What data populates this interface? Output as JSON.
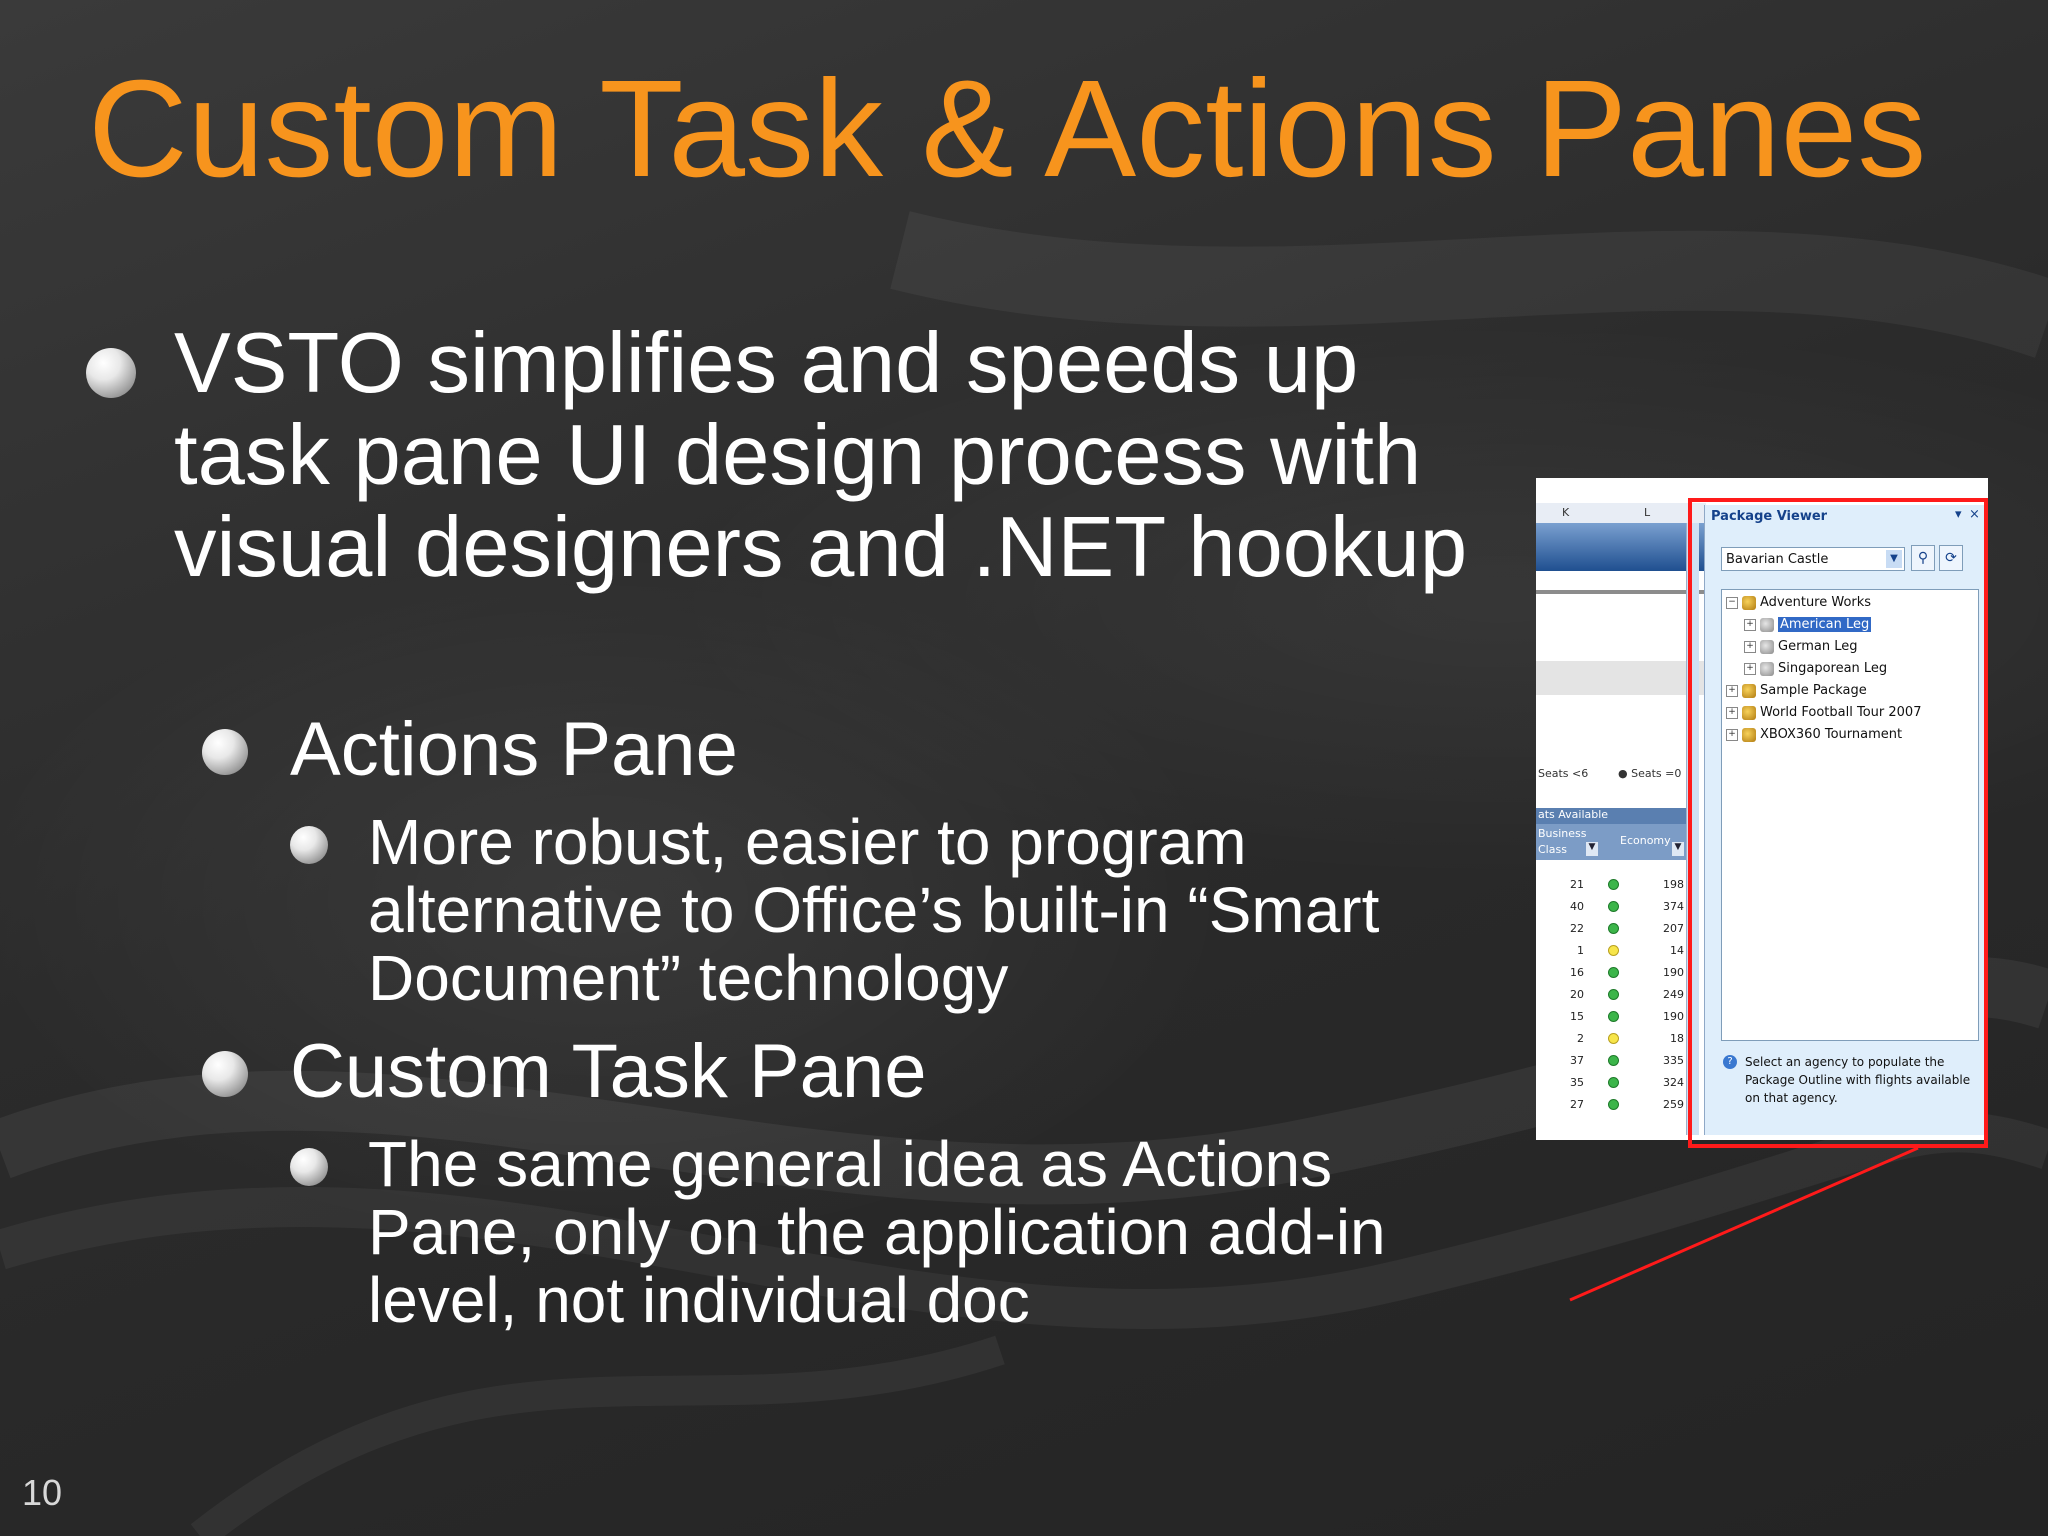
{
  "slide": {
    "title": "Custom Task & Actions Panes",
    "number": "10",
    "colors": {
      "title": "#f7941d",
      "text": "#ffffff",
      "highlight": "#ff1a1a"
    },
    "bullets": {
      "main": "VSTO simplifies and speeds up task pane UI design process with visual designers and .NET hookup",
      "actions_pane": "Actions Pane",
      "actions_pane_detail": "More robust, easier to program alternative to Office’s built-in “Smart Document” technology",
      "custom_task_pane": "Custom Task Pane",
      "custom_task_pane_detail": "The same general idea as Actions Pane, only on the application add-in level, not individual doc"
    }
  },
  "screenshot": {
    "excel": {
      "col_headers": [
        "K",
        "L"
      ],
      "legend": [
        "Seats <6",
        "Seats =0"
      ],
      "table_title": "ats Available",
      "col_business": "Business Class",
      "col_economy": "Economy",
      "rows": [
        {
          "business": "21",
          "status": "green",
          "economy": "198"
        },
        {
          "business": "40",
          "status": "green",
          "economy": "374"
        },
        {
          "business": "22",
          "status": "green",
          "economy": "207"
        },
        {
          "business": "1",
          "status": "yellow",
          "economy": "14"
        },
        {
          "business": "16",
          "status": "green",
          "economy": "190"
        },
        {
          "business": "20",
          "status": "green",
          "economy": "249"
        },
        {
          "business": "15",
          "status": "green",
          "economy": "190"
        },
        {
          "business": "2",
          "status": "yellow",
          "economy": "18"
        },
        {
          "business": "37",
          "status": "green",
          "economy": "335"
        },
        {
          "business": "35",
          "status": "green",
          "economy": "324"
        },
        {
          "business": "27",
          "status": "green",
          "economy": "259"
        }
      ]
    },
    "pane": {
      "title": "Package Viewer",
      "combo_value": "Bavarian Castle",
      "tree": {
        "adventure_works": "Adventure Works",
        "american_leg": "American Leg",
        "german_leg": "German Leg",
        "singaporean_leg": "Singaporean Leg",
        "sample_package": "Sample Package",
        "world_football": "World Football Tour 2007",
        "xbox_tournament": "XBOX360 Tournament"
      },
      "help_text": "Select an agency to populate the Package Outline with flights available on that agency."
    }
  }
}
